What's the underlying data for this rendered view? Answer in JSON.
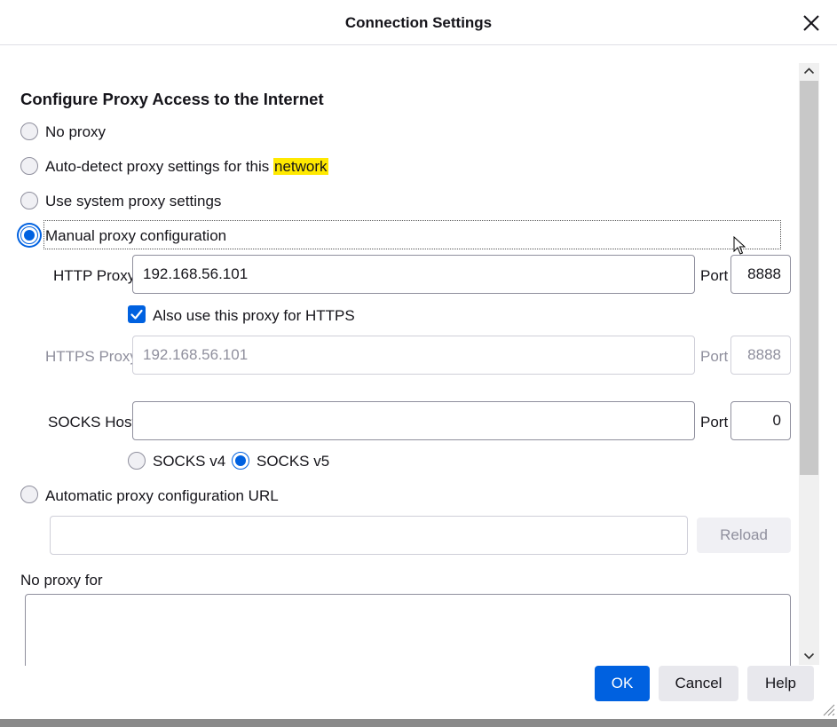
{
  "dialog": {
    "title": "Connection Settings",
    "close_icon": "close-icon"
  },
  "section": {
    "heading": "Configure Proxy Access to the Internet"
  },
  "options": {
    "no_proxy": {
      "label": "No proxy",
      "selected": false
    },
    "auto_detect": {
      "label_before": "Auto-detect proxy settings for this ",
      "label_highlight": "network",
      "highlight_color": "#ffe900",
      "selected": false
    },
    "system": {
      "label": "Use system proxy settings",
      "selected": false
    },
    "manual": {
      "label": "Manual proxy configuration",
      "selected": true
    },
    "auto_url": {
      "label": "Automatic proxy configuration URL",
      "selected": false
    }
  },
  "http_proxy": {
    "label": "HTTP Proxy",
    "value": "192.168.56.101",
    "port_label": "Port",
    "port": "8888"
  },
  "also_https": {
    "label": "Also use this proxy for HTTPS",
    "checked": true
  },
  "https_proxy": {
    "label": "HTTPS Proxy",
    "value": "192.168.56.101",
    "port_label": "Port",
    "port": "8888"
  },
  "socks": {
    "label": "SOCKS Host",
    "value": "",
    "port_label": "Port",
    "port": "0",
    "v4_label": "SOCKS v4",
    "v5_label": "SOCKS v5",
    "selected_version": "v5"
  },
  "auto_url": {
    "value": "",
    "reload_label": "Reload"
  },
  "no_proxy_for": {
    "label": "No proxy for",
    "value": ""
  },
  "footer": {
    "ok_label": "OK",
    "cancel_label": "Cancel",
    "help_label": "Help"
  },
  "colors": {
    "accent": "#0061e0",
    "highlight": "#ffe900",
    "disabled_text": "#8f8f9d"
  }
}
